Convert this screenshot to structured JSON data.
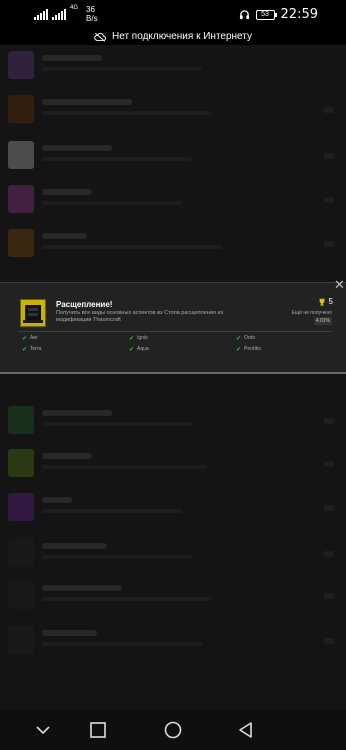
{
  "status_bar": {
    "network_type": "4G",
    "net_speed_value": "36",
    "net_speed_unit": "B/s",
    "battery_level": "53",
    "time": "22:59"
  },
  "offline_banner": {
    "text": "Нет подключения к Интернету",
    "icon": "cloud-off-icon"
  },
  "achievement": {
    "title": "Расщепление!",
    "description": "Получить все виды основных аспектов из Стола расщепления из модификации Thaumcraft",
    "trophy_count": "5",
    "status_text": "Ещё не получено",
    "percent": "4.01%",
    "aspects": [
      "Aer",
      "Ignis",
      "Ordo",
      "Terra",
      "Aqua",
      "Perditio"
    ],
    "icon": "cube-icon",
    "close_icon": "close-icon"
  },
  "colors": {
    "accent_check": "#4caf50",
    "trophy": "#e6c200",
    "achievement_icon": "#c8b400"
  },
  "navigation": {
    "back": "chevron-down-icon",
    "recent": "square-icon",
    "home": "circle-icon",
    "back_triangle": "triangle-back-icon"
  }
}
